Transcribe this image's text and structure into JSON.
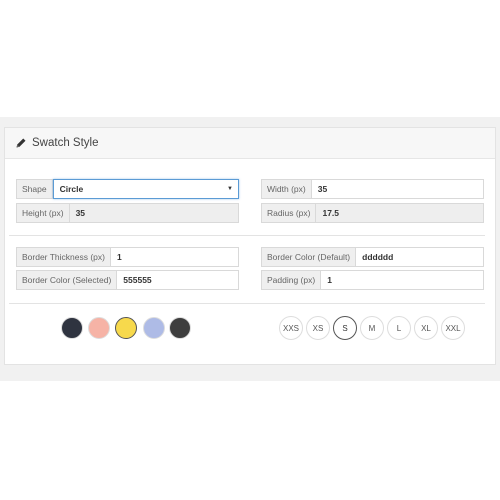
{
  "panel": {
    "title": "Swatch Style"
  },
  "fields": {
    "shape": {
      "label": "Shape",
      "value": "Circle"
    },
    "width": {
      "label": "Width (px)",
      "value": "35"
    },
    "height": {
      "label": "Height (px)",
      "value": "35"
    },
    "radius": {
      "label": "Radius (px)",
      "value": "17.5"
    },
    "border_thickness": {
      "label": "Border Thickness (px)",
      "value": "1"
    },
    "border_color_default": {
      "label": "Border Color (Default)",
      "value": "dddddd"
    },
    "border_color_selected": {
      "label": "Border Color (Selected)",
      "value": "555555"
    },
    "padding": {
      "label": "Padding (px)",
      "value": "1"
    }
  },
  "color_swatches": [
    {
      "color": "#2f3440",
      "selected": false
    },
    {
      "color": "#f6b3a6",
      "selected": false
    },
    {
      "color": "#f7d94c",
      "selected": true
    },
    {
      "color": "#aebbe6",
      "selected": false
    },
    {
      "color": "#3e3e3e",
      "selected": false
    }
  ],
  "size_swatches": [
    {
      "label": "XXS",
      "selected": false
    },
    {
      "label": "XS",
      "selected": false
    },
    {
      "label": "S",
      "selected": true
    },
    {
      "label": "M",
      "selected": false
    },
    {
      "label": "L",
      "selected": false
    },
    {
      "label": "XL",
      "selected": false
    },
    {
      "label": "XXL",
      "selected": false
    }
  ]
}
